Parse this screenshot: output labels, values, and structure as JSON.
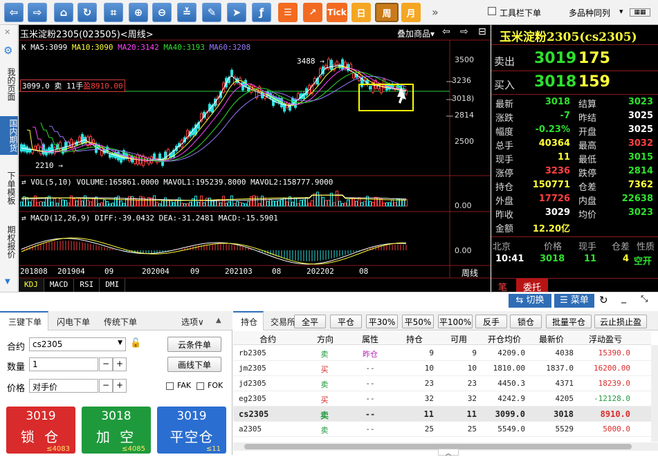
{
  "toolbar": {
    "tick_label": "Tick",
    "day_label": "日",
    "week_label": "周",
    "month_label": "月",
    "more_label": "»",
    "toolbar_checkbox_label": "工具栏下单",
    "multi_label": "多品种同列"
  },
  "sidebar": {
    "items": [
      "我的页面",
      "国内期货",
      "下单模板",
      "期权报价"
    ]
  },
  "chart": {
    "title": "玉米淀粉2305(023505)<周线>",
    "overlay_label": "叠加商品▾",
    "ma_row": {
      "k": "K",
      "ma5": "MA5:3099",
      "ma10": "MA10:3090",
      "ma20": "MA20:3142",
      "ma40": "MA40:3193",
      "ma60": "MA60:3208"
    },
    "position_line": {
      "price": "3099.0",
      "side": "卖",
      "lots": "11手",
      "pnl": "盈8910.00"
    },
    "high_marker": "3488",
    "low_marker": "2210",
    "price_ticks": [
      "3500",
      "3236",
      "3018)",
      "2814",
      "2500"
    ],
    "vol_label": "VOL(5,10) VOLUME:165861.0000 MAVOL1:195239.8000 MAVOL2:158777.9000",
    "vol_tick": "0.00",
    "macd_label": "MACD(12,26,9) DIFF:-39.0432 DEA:-31.2481 MACD:-15.5901",
    "macd_tick": "0.00",
    "x_ticks": [
      "201808",
      "201904",
      "09",
      "202004",
      "09",
      "202103",
      "08",
      "202202",
      "08"
    ],
    "period_label": "周线",
    "indicator_tabs": [
      "KDJ",
      "MACD",
      "RSI",
      "DMI"
    ]
  },
  "quote": {
    "name": "玉米淀粉2305(cs2305)",
    "ask_label": "卖出",
    "ask_price": "3019",
    "ask_vol": "175",
    "bid_label": "买入",
    "bid_price": "3018",
    "bid_vol": "159",
    "rows_left": [
      {
        "label": "最新",
        "value": "3018",
        "color": "green"
      },
      {
        "label": "涨跌",
        "value": "-7",
        "color": "green"
      },
      {
        "label": "幅度",
        "value": "-0.23%",
        "color": "green"
      },
      {
        "label": "总手",
        "value": "40364",
        "color": "yellow"
      },
      {
        "label": "现手",
        "value": "11",
        "color": "yellow"
      },
      {
        "label": "涨停",
        "value": "3236",
        "color": "red"
      },
      {
        "label": "持仓",
        "value": "150771",
        "color": "yellow"
      },
      {
        "label": "外盘",
        "value": "17726",
        "color": "red"
      },
      {
        "label": "昨收",
        "value": "3029",
        "color": "white"
      },
      {
        "label": "金额",
        "value": "12.20亿",
        "color": "yellow"
      }
    ],
    "rows_right": [
      {
        "label": "结算",
        "value": "3023",
        "color": "green"
      },
      {
        "label": "昨结",
        "value": "3025",
        "color": "white"
      },
      {
        "label": "开盘",
        "value": "3025",
        "color": "white"
      },
      {
        "label": "最高",
        "value": "3032",
        "color": "red"
      },
      {
        "label": "最低",
        "value": "3015",
        "color": "green"
      },
      {
        "label": "跌停",
        "value": "2814",
        "color": "green"
      },
      {
        "label": "仓差",
        "value": "7362",
        "color": "yellow"
      },
      {
        "label": "内盘",
        "value": "22638",
        "color": "green"
      },
      {
        "label": "均价",
        "value": "3023",
        "color": "green"
      }
    ],
    "tick_header": {
      "region": "北京",
      "price": "价格",
      "vol": "现手",
      "oi": "仓差",
      "nature": "性质"
    },
    "tick_row": {
      "time": "10:41",
      "price": "3018",
      "vol": "11",
      "oi": "4",
      "nature": "空开"
    },
    "tabs": [
      "笔",
      "委托"
    ]
  },
  "midbar": {
    "switch_label": "⇆ 切换",
    "menu_label": "☰ 菜单"
  },
  "order": {
    "tabs": [
      "三键下单",
      "闪电下单",
      "传统下单"
    ],
    "options_label": "选项∨",
    "contract_label": "合约",
    "contract_value": "cs2305",
    "qty_label": "数量",
    "qty_value": "1",
    "price_label": "价格",
    "price_value": "对手价",
    "cloud_btn": "云条件单",
    "line_btn": "画线下单",
    "fak_label": "FAK",
    "fok_label": "FOK",
    "buttons": [
      {
        "price": "3019",
        "action": "锁 仓",
        "qty": "≤4083",
        "color": "#d92b2b"
      },
      {
        "price": "3018",
        "action": "加 空",
        "qty": "≤4085",
        "color": "#1e9a3c"
      },
      {
        "price": "3019",
        "action": "平空仓",
        "qty": "≤11",
        "color": "#2b6ed1"
      }
    ]
  },
  "positions": {
    "tabs": [
      "持仓",
      "交易所"
    ],
    "actions": [
      "全平",
      "平仓",
      "平30%",
      "平50%",
      "平100%",
      "反手",
      "锁仓",
      "批量平仓",
      "云止损止盈"
    ],
    "columns": [
      "合约",
      "方向",
      "属性",
      "持仓",
      "可用",
      "开仓均价",
      "最新价",
      "浮动盈亏"
    ],
    "rows": [
      {
        "contract": "rb2305",
        "dir": "卖",
        "attr": "昨仓",
        "pos": "9",
        "avail": "9",
        "open": "4209.0",
        "last": "4038",
        "pnl": "15390.0"
      },
      {
        "contract": "jm2305",
        "dir": "买",
        "attr": "--",
        "pos": "10",
        "avail": "10",
        "open": "1810.00",
        "last": "1837.0",
        "pnl": "16200.00"
      },
      {
        "contract": "jd2305",
        "dir": "卖",
        "attr": "--",
        "pos": "23",
        "avail": "23",
        "open": "4450.3",
        "last": "4371",
        "pnl": "18239.0"
      },
      {
        "contract": "eg2305",
        "dir": "买",
        "attr": "--",
        "pos": "32",
        "avail": "32",
        "open": "4242.9",
        "last": "4205",
        "pnl": "-12128.0"
      },
      {
        "contract": "cs2305",
        "dir": "卖",
        "attr": "--",
        "pos": "11",
        "avail": "11",
        "open": "3099.0",
        "last": "3018",
        "pnl": "8910.0"
      },
      {
        "contract": "a2305",
        "dir": "卖",
        "attr": "--",
        "pos": "25",
        "avail": "25",
        "open": "5549.0",
        "last": "5529",
        "pnl": "5000.0"
      }
    ]
  }
}
